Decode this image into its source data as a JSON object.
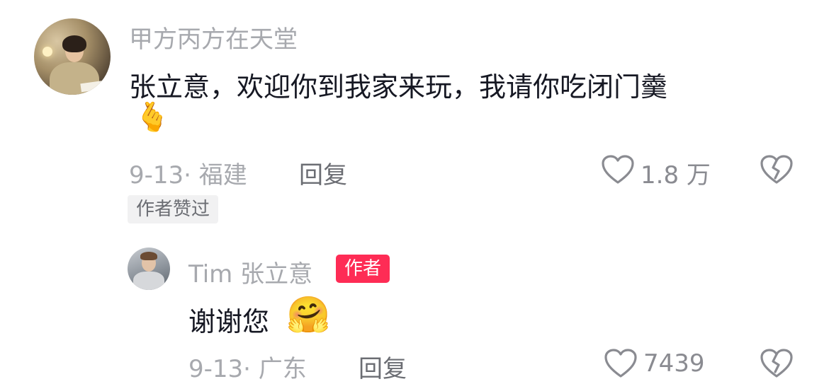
{
  "comment": {
    "username": "甲方丙方在天堂",
    "text": "张立意，欢迎你到我家来玩，我请你吃闭门羹",
    "emoji": "🫰",
    "meta": "9-13· 福建",
    "reply_label": "回复",
    "like_count": "1.8 万",
    "author_liked_badge": "作者赞过"
  },
  "reply": {
    "username": "Tim 张立意",
    "author_badge": "作者",
    "text": "谢谢您",
    "emoji": "🤗",
    "meta": "9-13· 广东",
    "reply_label": "回复",
    "like_count": "7439"
  },
  "icons": {
    "like": "heart-outline-icon",
    "dislike": "broken-heart-icon"
  },
  "colors": {
    "author_badge_bg": "#fe2c55",
    "muted_text": "#a7a9ae",
    "primary_text": "#161823"
  }
}
